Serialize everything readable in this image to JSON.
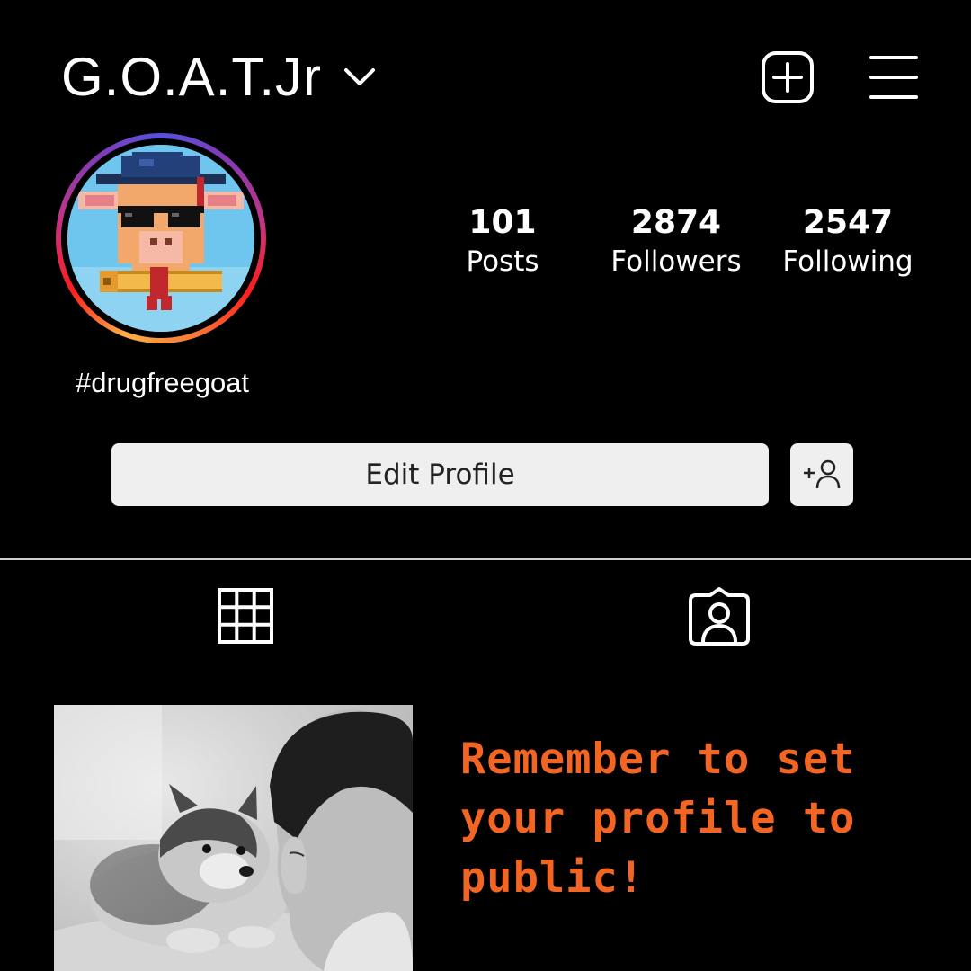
{
  "header": {
    "username": "G.O.A.T.Jr",
    "icons": {
      "account_switcher": "chevron-down-icon",
      "new_post": "plus-square-icon",
      "menu": "hamburger-menu-icon"
    }
  },
  "profile": {
    "avatar": "pixel-art-goat-graduate",
    "bio": "#drugfreegoat",
    "ring_colors": [
      "#fcb045",
      "#fd1d1d",
      "#c13584",
      "#833ab4"
    ]
  },
  "stats": [
    {
      "value": "101",
      "label": "Posts"
    },
    {
      "value": "2874",
      "label": "Followers"
    },
    {
      "value": "2547",
      "label": "Following"
    }
  ],
  "actions": {
    "edit_profile": "Edit Profile",
    "add_friend_icon": "add-person-icon"
  },
  "tabs": [
    {
      "name": "grid",
      "icon": "grid-icon"
    },
    {
      "name": "tagged",
      "icon": "tagged-person-icon"
    }
  ],
  "posts": [
    {
      "type": "photo",
      "description_icon": "child-with-puppy-photo"
    }
  ],
  "notice": {
    "text": "Remember to set your profile to public!",
    "color": "#f26522"
  }
}
